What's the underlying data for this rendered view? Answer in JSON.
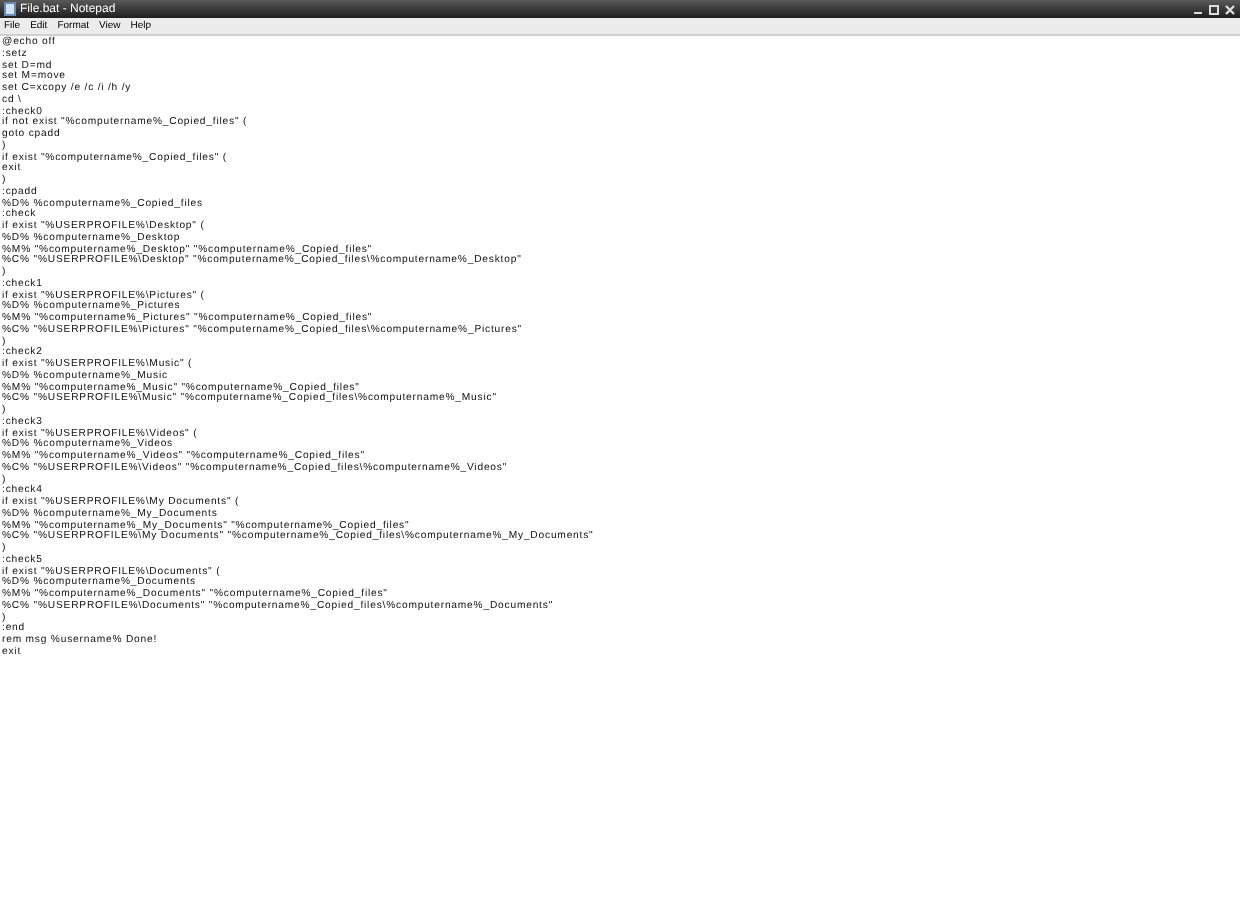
{
  "window": {
    "title": "File.bat - Notepad"
  },
  "menu": [
    "File",
    "Edit",
    "Format",
    "View",
    "Help"
  ],
  "lines": [
    "@echo off",
    ":setz",
    "set D=md",
    "set M=move",
    "set C=xcopy /e /c /i /h /y",
    "cd \\",
    ":check0",
    "if not exist \"%computername%_Copied_files\" (",
    "goto cpadd",
    ")",
    "if exist \"%computername%_Copied_files\" (",
    "exit",
    ")",
    ":cpadd",
    "%D% %computername%_Copied_files",
    ":check",
    "if exist \"%USERPROFILE%\\Desktop\" (",
    "%D% %computername%_Desktop",
    "%M% \"%computername%_Desktop\" \"%computername%_Copied_files\"",
    "%C% \"%USERPROFILE%\\Desktop\" \"%computername%_Copied_files\\%computername%_Desktop\"",
    ")",
    ":check1",
    "if exist \"%USERPROFILE%\\Pictures\" (",
    "%D% %computername%_Pictures",
    "%M% \"%computername%_Pictures\" \"%computername%_Copied_files\"",
    "%C% \"%USERPROFILE%\\Pictures\" \"%computername%_Copied_files\\%computername%_Pictures\"",
    ")",
    ":check2",
    "if exist \"%USERPROFILE%\\Music\" (",
    "%D% %computername%_Music",
    "%M% \"%computername%_Music\" \"%computername%_Copied_files\"",
    "%C% \"%USERPROFILE%\\Music\" \"%computername%_Copied_files\\%computername%_Music\"",
    ")",
    ":check3",
    "if exist \"%USERPROFILE%\\Videos\" (",
    "%D% %computername%_Videos",
    "%M% \"%computername%_Videos\" \"%computername%_Copied_files\"",
    "%C% \"%USERPROFILE%\\Videos\" \"%computername%_Copied_files\\%computername%_Videos\"",
    ")",
    ":check4",
    "if exist \"%USERPROFILE%\\My Documents\" (",
    "%D% %computername%_My_Documents",
    "%M% \"%computername%_My_Documents\" \"%computername%_Copied_files\"",
    "%C% \"%USERPROFILE%\\My Documents\" \"%computername%_Copied_files\\%computername%_My_Documents\"",
    ")",
    ":check5",
    "if exist \"%USERPROFILE%\\Documents\" (",
    "%D% %computername%_Documents",
    "%M% \"%computername%_Documents\" \"%computername%_Copied_files\"",
    "%C% \"%USERPROFILE%\\Documents\" \"%computername%_Copied_files\\%computername%_Documents\"",
    ")",
    ":end",
    "rem msg %username% Done!",
    "exit"
  ]
}
